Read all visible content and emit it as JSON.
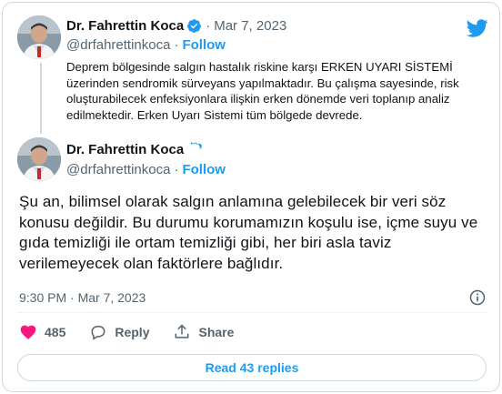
{
  "quoted_tweet": {
    "author_name": "Dr. Fahrettin Koca",
    "handle": "@drfahrettinkoca",
    "separator": "·",
    "follow_label": "Follow",
    "date": "Mar 7, 2023",
    "text": "Deprem bölgesinde salgın hastalık riskine karşı ERKEN UYARI SİSTEMİ üzerinden sendromik sürveyans yapılmaktadır. Bu çalışma sayesinde, risk oluşturabilecek enfeksiyonlara ilişkin erken dönemde veri toplanıp analiz edilmektedir. Erken Uyarı Sistemi tüm bölgede devrede."
  },
  "main_tweet": {
    "author_name": "Dr. Fahrettin Koca",
    "handle": "@drfahrettinkoca",
    "separator": "·",
    "follow_label": "Follow",
    "text": "Şu an, bilimsel olarak salgın anlamına gelebilecek bir veri söz konusu değildir. Bu durumu korumamızın koşulu ise, içme suyu ve gıda temizliği ile ortam temizliği gibi, her biri asla taviz verilemeyecek olan faktörlere bağlıdır.",
    "timestamp": "9:30 PM · Mar 7, 2023"
  },
  "actions": {
    "like_count": "485",
    "reply_label": "Reply",
    "share_label": "Share"
  },
  "read_replies_label": "Read 43 replies",
  "icons": {
    "brand": "twitter-bird-icon",
    "verified": "verified-badge-icon",
    "like": "heart-icon",
    "reply": "reply-bubble-icon",
    "share": "share-icon",
    "info": "info-icon"
  },
  "colors": {
    "accent": "#1d9bf0",
    "like": "#f91880",
    "secondary_text": "#536471",
    "border": "#cfd9de"
  }
}
